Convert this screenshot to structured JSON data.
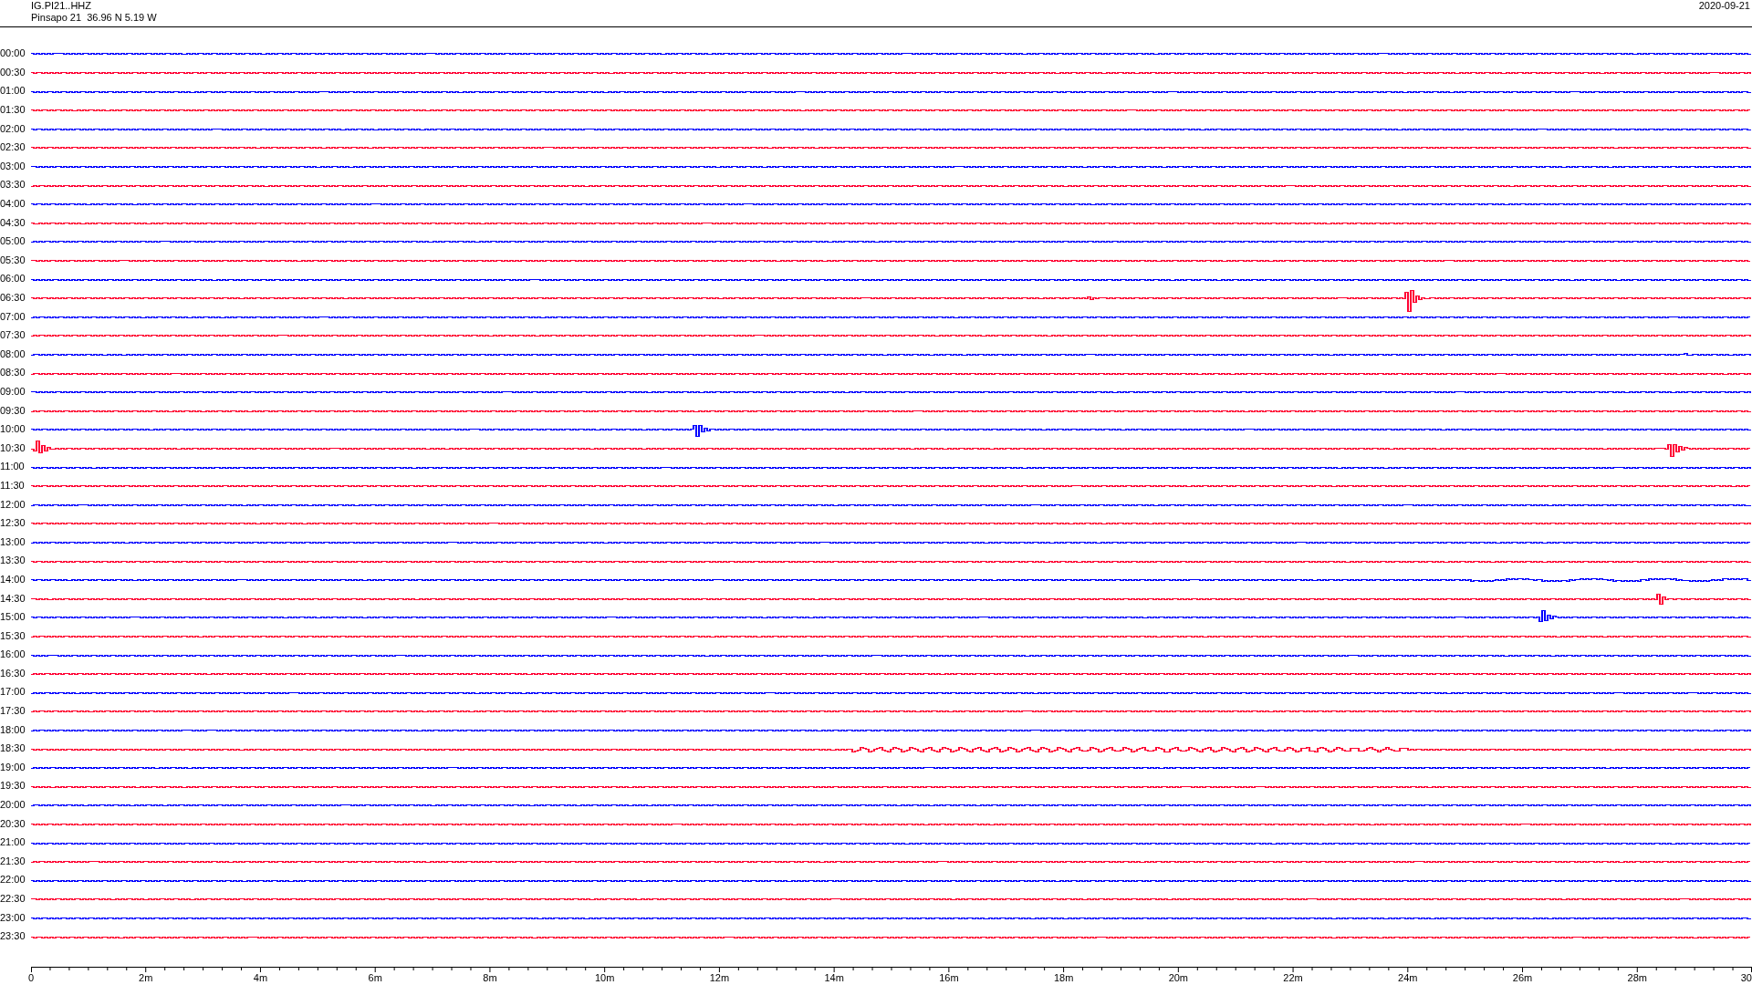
{
  "header": {
    "station": "IG.PI21..HHZ",
    "location": "Pinsapo 21  36.96 N 5.19 W",
    "date": "2020-09-21"
  },
  "traces": [
    {
      "label": "00:00",
      "color": "#0000ff"
    },
    {
      "label": "00:30",
      "color": "#ff0033"
    },
    {
      "label": "01:00",
      "color": "#0000ff"
    },
    {
      "label": "01:30",
      "color": "#ff0033"
    },
    {
      "label": "02:00",
      "color": "#0000ff"
    },
    {
      "label": "02:30",
      "color": "#ff0033"
    },
    {
      "label": "03:00",
      "color": "#0000ff"
    },
    {
      "label": "03:30",
      "color": "#ff0033"
    },
    {
      "label": "04:00",
      "color": "#0000ff"
    },
    {
      "label": "04:30",
      "color": "#ff0033"
    },
    {
      "label": "05:00",
      "color": "#0000ff"
    },
    {
      "label": "05:30",
      "color": "#ff0033"
    },
    {
      "label": "06:00",
      "color": "#0000ff"
    },
    {
      "label": "06:30",
      "color": "#ff0033"
    },
    {
      "label": "07:00",
      "color": "#0000ff"
    },
    {
      "label": "07:30",
      "color": "#ff0033"
    },
    {
      "label": "08:00",
      "color": "#0000ff"
    },
    {
      "label": "08:30",
      "color": "#ff0033"
    },
    {
      "label": "09:00",
      "color": "#0000ff"
    },
    {
      "label": "09:30",
      "color": "#ff0033"
    },
    {
      "label": "10:00",
      "color": "#0000ff"
    },
    {
      "label": "10:30",
      "color": "#ff0033"
    },
    {
      "label": "11:00",
      "color": "#0000ff"
    },
    {
      "label": "11:30",
      "color": "#ff0033"
    },
    {
      "label": "12:00",
      "color": "#0000ff"
    },
    {
      "label": "12:30",
      "color": "#ff0033"
    },
    {
      "label": "13:00",
      "color": "#0000ff"
    },
    {
      "label": "13:30",
      "color": "#ff0033"
    },
    {
      "label": "14:00",
      "color": "#0000ff"
    },
    {
      "label": "14:30",
      "color": "#ff0033"
    },
    {
      "label": "15:00",
      "color": "#0000ff"
    },
    {
      "label": "15:30",
      "color": "#ff0033"
    },
    {
      "label": "16:00",
      "color": "#0000ff"
    },
    {
      "label": "16:30",
      "color": "#ff0033"
    },
    {
      "label": "17:00",
      "color": "#0000ff"
    },
    {
      "label": "17:30",
      "color": "#ff0033"
    },
    {
      "label": "18:00",
      "color": "#0000ff"
    },
    {
      "label": "18:30",
      "color": "#ff0033"
    },
    {
      "label": "19:00",
      "color": "#0000ff"
    },
    {
      "label": "19:30",
      "color": "#ff0033"
    },
    {
      "label": "20:00",
      "color": "#0000ff"
    },
    {
      "label": "20:30",
      "color": "#ff0033"
    },
    {
      "label": "21:00",
      "color": "#0000ff"
    },
    {
      "label": "21:30",
      "color": "#ff0033"
    },
    {
      "label": "22:00",
      "color": "#0000ff"
    },
    {
      "label": "22:30",
      "color": "#ff0033"
    },
    {
      "label": "23:00",
      "color": "#0000ff"
    },
    {
      "label": "23:30",
      "color": "#ff0033"
    }
  ],
  "x_axis": {
    "ticks": [
      "0",
      "2m",
      "4m",
      "6m",
      "8m",
      "10m",
      "12m",
      "14m",
      "16m",
      "18m",
      "20m",
      "22m",
      "24m",
      "26m",
      "28m",
      "30"
    ]
  }
}
